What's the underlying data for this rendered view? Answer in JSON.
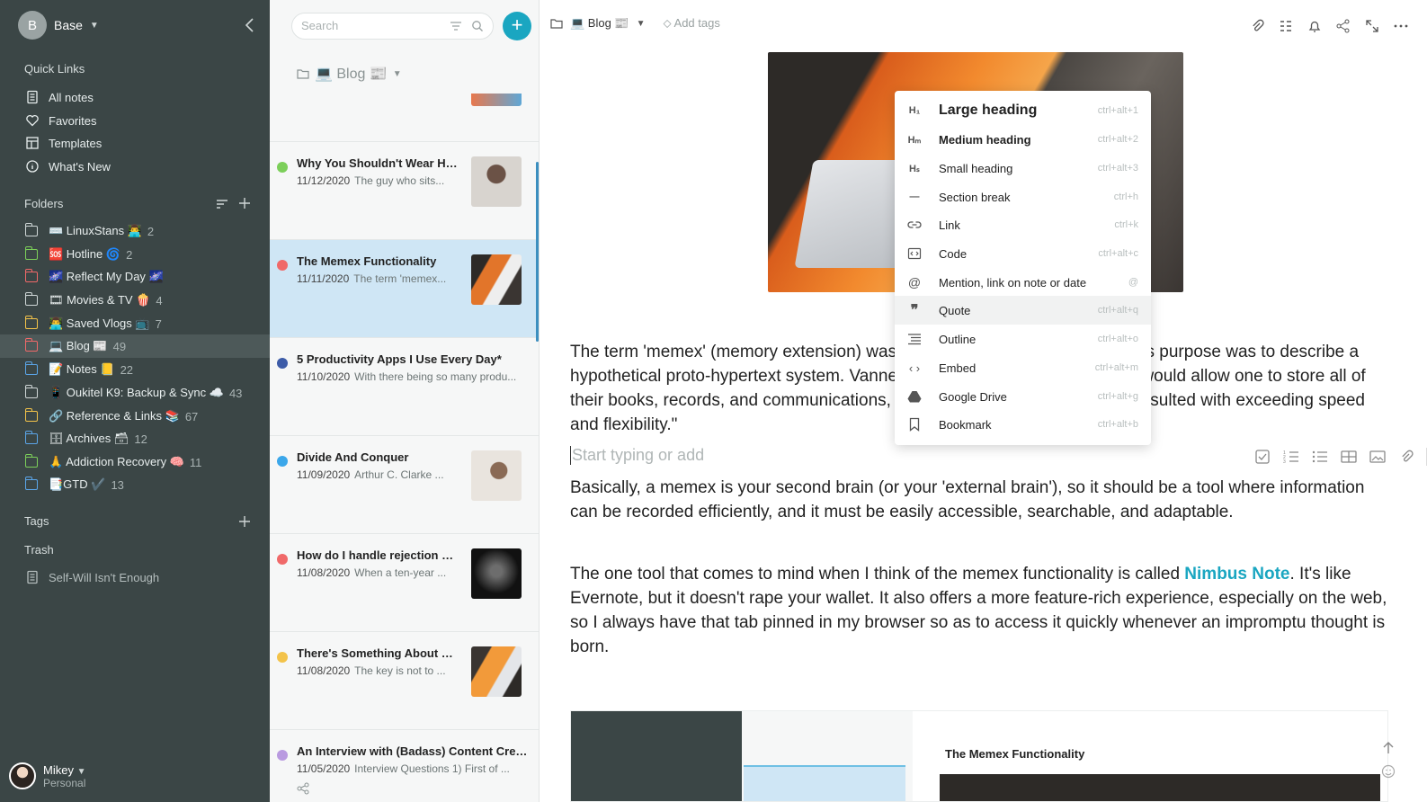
{
  "workspace": {
    "avatar_letter": "B",
    "name": "Base"
  },
  "sidebar": {
    "quick_links_title": "Quick Links",
    "quick_links": [
      {
        "label": "All notes",
        "icon": "notes-icon"
      },
      {
        "label": "Favorites",
        "icon": "heart-icon"
      },
      {
        "label": "Templates",
        "icon": "templates-icon"
      },
      {
        "label": "What's New",
        "icon": "info-icon"
      }
    ],
    "folders_title": "Folders",
    "folders": [
      {
        "label": "⌨️ LinuxStans 👨‍💻",
        "count": "2",
        "color": "#cfd6d6"
      },
      {
        "label": "🆘 Hotline 🌀",
        "count": "2",
        "color": "#7ccf5a"
      },
      {
        "label": "🌌 Reflect My Day 🌌",
        "count": "",
        "color": "#f06969"
      },
      {
        "label": "🎞 Movies & TV 🍿",
        "count": "4",
        "color": "#cfd6d6"
      },
      {
        "label": "👨‍💻 Saved Vlogs 📺",
        "count": "7",
        "color": "#f3c34a"
      },
      {
        "label": "💻 Blog 📰",
        "count": "49",
        "color": "#f06969"
      },
      {
        "label": "📝 Notes 📒",
        "count": "22",
        "color": "#5ba5e8"
      },
      {
        "label": "📱 Oukitel K9: Backup & Sync ☁️",
        "count": "43",
        "color": "#cfd6d6"
      },
      {
        "label": "🔗 Reference & Links 📚",
        "count": "67",
        "color": "#f3c34a"
      },
      {
        "label": "🗄 Archives 🗃",
        "count": "12",
        "color": "#5ba5e8"
      },
      {
        "label": "🙏 Addiction Recovery 🧠",
        "count": "11",
        "color": "#7ccf5a"
      },
      {
        "label": "📑GTD ✔️",
        "count": "13",
        "color": "#5ba5e8"
      }
    ],
    "tags_title": "Tags",
    "trash_title": "Trash",
    "trash_items": [
      "Self-Will Isn't Enough"
    ]
  },
  "user": {
    "name": "Mikey",
    "subtitle": "Personal"
  },
  "note_list": {
    "search_placeholder": "Search",
    "folder_label": "💻 Blog 📰",
    "notes": [
      {
        "title": "Why You Shouldn't Wear He...",
        "date": "11/12/2020",
        "preview": "The guy who sits...",
        "dot": "#7ccf5a",
        "thumb": "headphones-photo"
      },
      {
        "title": "The Memex Functionality",
        "date": "11/11/2020",
        "preview": "The term 'memex...",
        "dot": "#f06969",
        "thumb": "laptop-photo"
      },
      {
        "title": "5 Productivity Apps I Use Every Day*",
        "date": "11/10/2020",
        "preview": "With there being so many produ...",
        "dot": "#3d5ca8",
        "thumb": ""
      },
      {
        "title": "Divide And Conquer",
        "date": "11/09/2020",
        "preview": "Arthur C. Clarke ...",
        "dot": "#3ba7ea",
        "thumb": "woman-photo"
      },
      {
        "title": "How do I handle rejection an...",
        "date": "11/08/2020",
        "preview": "When a ten-year ...",
        "dot": "#f06969",
        "thumb": "dark-photo"
      },
      {
        "title": "There's Something About Bl...",
        "date": "11/08/2020",
        "preview": "The key is not to ...",
        "dot": "#f3c34a",
        "thumb": "blogger-photo"
      },
      {
        "title": "An Interview with (Badass) Content Creat...",
        "date": "11/05/2020",
        "preview": "Interview Questions 1) First of ...",
        "dot": "#b99ae0",
        "thumb": ""
      }
    ]
  },
  "editor": {
    "folder_label": "💻 Blog 📰",
    "add_tags": "Add tags",
    "para1": "The term 'memex' (memory extension) was coined by Vannevar Bush, and its purpose was to describe a hypothetical proto-hypertext system. Vannevar explained it as a device that would allow one to store all of their books, records, and communications, mechanized so that it may be consulted with exceeding speed and flexibility.\"",
    "placeholder": "Start typing or add",
    "para2": "Basically, a memex is your second brain (or your 'external brain'), so it should be a tool where information can be recorded efficiently, and it must be easily accessible, searchable, and adaptable.",
    "para3_before": "The one tool that comes to mind when I think of the memex functionality is called ",
    "para3_link": "Nimbus Note",
    "para3_after": ". It's like Evernote, but it doesn't rape your wallet. It also offers a more feature-rich experience, especially on the web, so I always have that tab pinned in my browser so as to access it quickly whenever an impromptu thought is born.",
    "embedded": {
      "title": "The Memex Functionality"
    }
  },
  "insert_menu": [
    {
      "label": "Large heading",
      "shortcut": "ctrl+alt+1",
      "icon": "h1-icon"
    },
    {
      "label": "Medium heading",
      "shortcut": "ctrl+alt+2",
      "icon": "h2-icon"
    },
    {
      "label": "Small heading",
      "shortcut": "ctrl+alt+3",
      "icon": "h3-icon"
    },
    {
      "label": "Section break",
      "shortcut": "ctrl+h",
      "icon": "divider-icon"
    },
    {
      "label": "Link",
      "shortcut": "ctrl+k",
      "icon": "link-icon"
    },
    {
      "label": "Code",
      "shortcut": "ctrl+alt+c",
      "icon": "code-icon"
    },
    {
      "label": "Mention, link on note or date",
      "shortcut": "@",
      "icon": "at-icon"
    },
    {
      "label": "Quote",
      "shortcut": "ctrl+alt+q",
      "icon": "quote-icon"
    },
    {
      "label": "Outline",
      "shortcut": "ctrl+alt+o",
      "icon": "outline-icon"
    },
    {
      "label": "Embed",
      "shortcut": "ctrl+alt+m",
      "icon": "embed-icon"
    },
    {
      "label": "Google Drive",
      "shortcut": "ctrl+alt+g",
      "icon": "google-drive-icon"
    },
    {
      "label": "Bookmark",
      "shortcut": "ctrl+alt+b",
      "icon": "bookmark-icon"
    }
  ],
  "colors": {
    "accent": "#1aa6c1",
    "sidebar_bg": "#3b4646",
    "selected_note": "#cfe6f5"
  }
}
